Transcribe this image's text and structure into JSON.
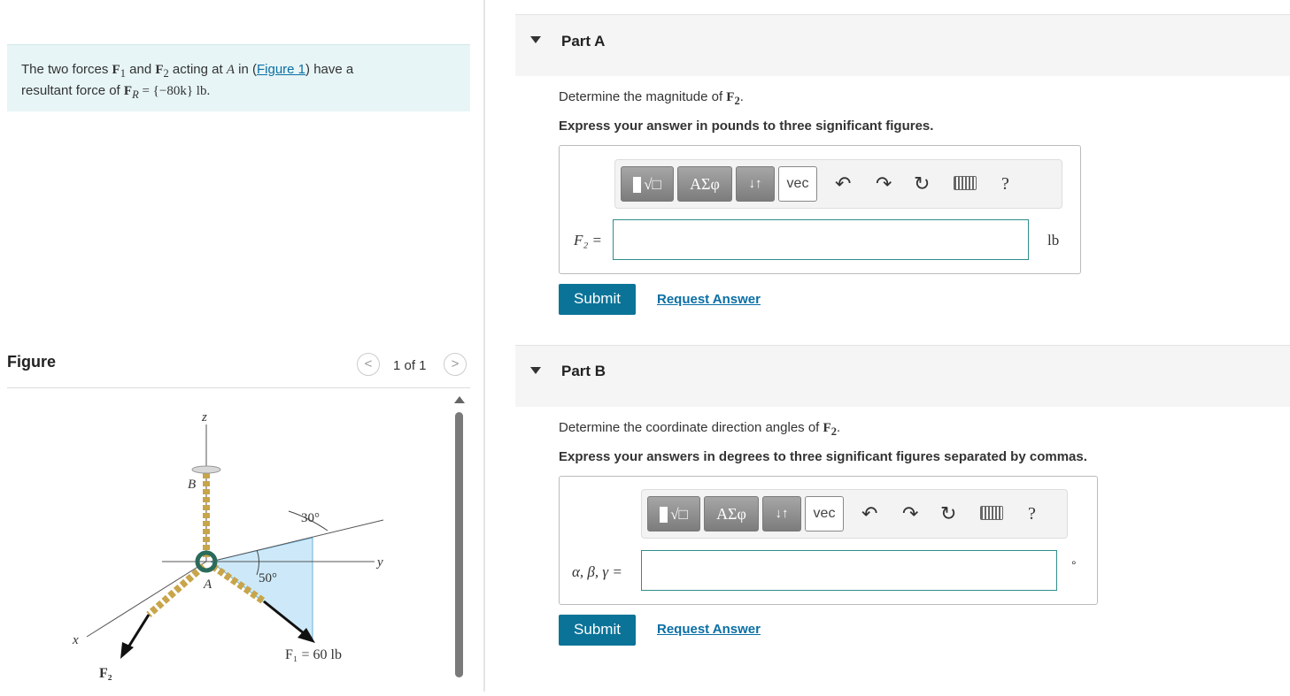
{
  "problem": {
    "text_1": "The two forces ",
    "f1": "F",
    "f1_sub": "1",
    "text_2": " and ",
    "f2": "F",
    "f2_sub": "2",
    "text_3": " acting at ",
    "point": "A",
    "text_4": " in (",
    "figure_link": "Figure 1",
    "text_5": ") have a",
    "text_6": "resultant force of ",
    "fr": "F",
    "fr_sub": "R",
    "fr_value": " = {−80k} lb."
  },
  "figure_panel": {
    "title": "Figure",
    "page_label": "1 of 1",
    "prev": "<",
    "next": ">",
    "labels": {
      "z": "z",
      "y": "y",
      "x": "x",
      "b": "B",
      "a": "A",
      "angle30": "30°",
      "angle50": "50°",
      "f1": "F₁ = 60 lb",
      "f2": "F₂"
    }
  },
  "part_a": {
    "title": "Part A",
    "question": "Determine the magnitude of ",
    "question_var": "F",
    "question_sub": "2",
    "question_end": ".",
    "instruction": "Express your answer in pounds to three significant figures.",
    "label": "F₂ =",
    "unit": "lb",
    "submit": "Submit",
    "request": "Request Answer"
  },
  "part_b": {
    "title": "Part B",
    "question": "Determine the coordinate direction angles of ",
    "question_var": "F",
    "question_sub": "2",
    "question_end": ".",
    "instruction": "Express your answers in degrees to three significant figures separated by commas.",
    "label": "α, β, γ =",
    "unit": "°",
    "submit": "Submit",
    "request": "Request Answer"
  },
  "toolbar": {
    "greek": "ΑΣφ",
    "arrows": "↓↑",
    "vec": "vec",
    "help": "?"
  },
  "icons": [
    "template-icon",
    "undo-icon",
    "redo-icon",
    "reset-icon",
    "keyboard-icon",
    "help-icon"
  ]
}
